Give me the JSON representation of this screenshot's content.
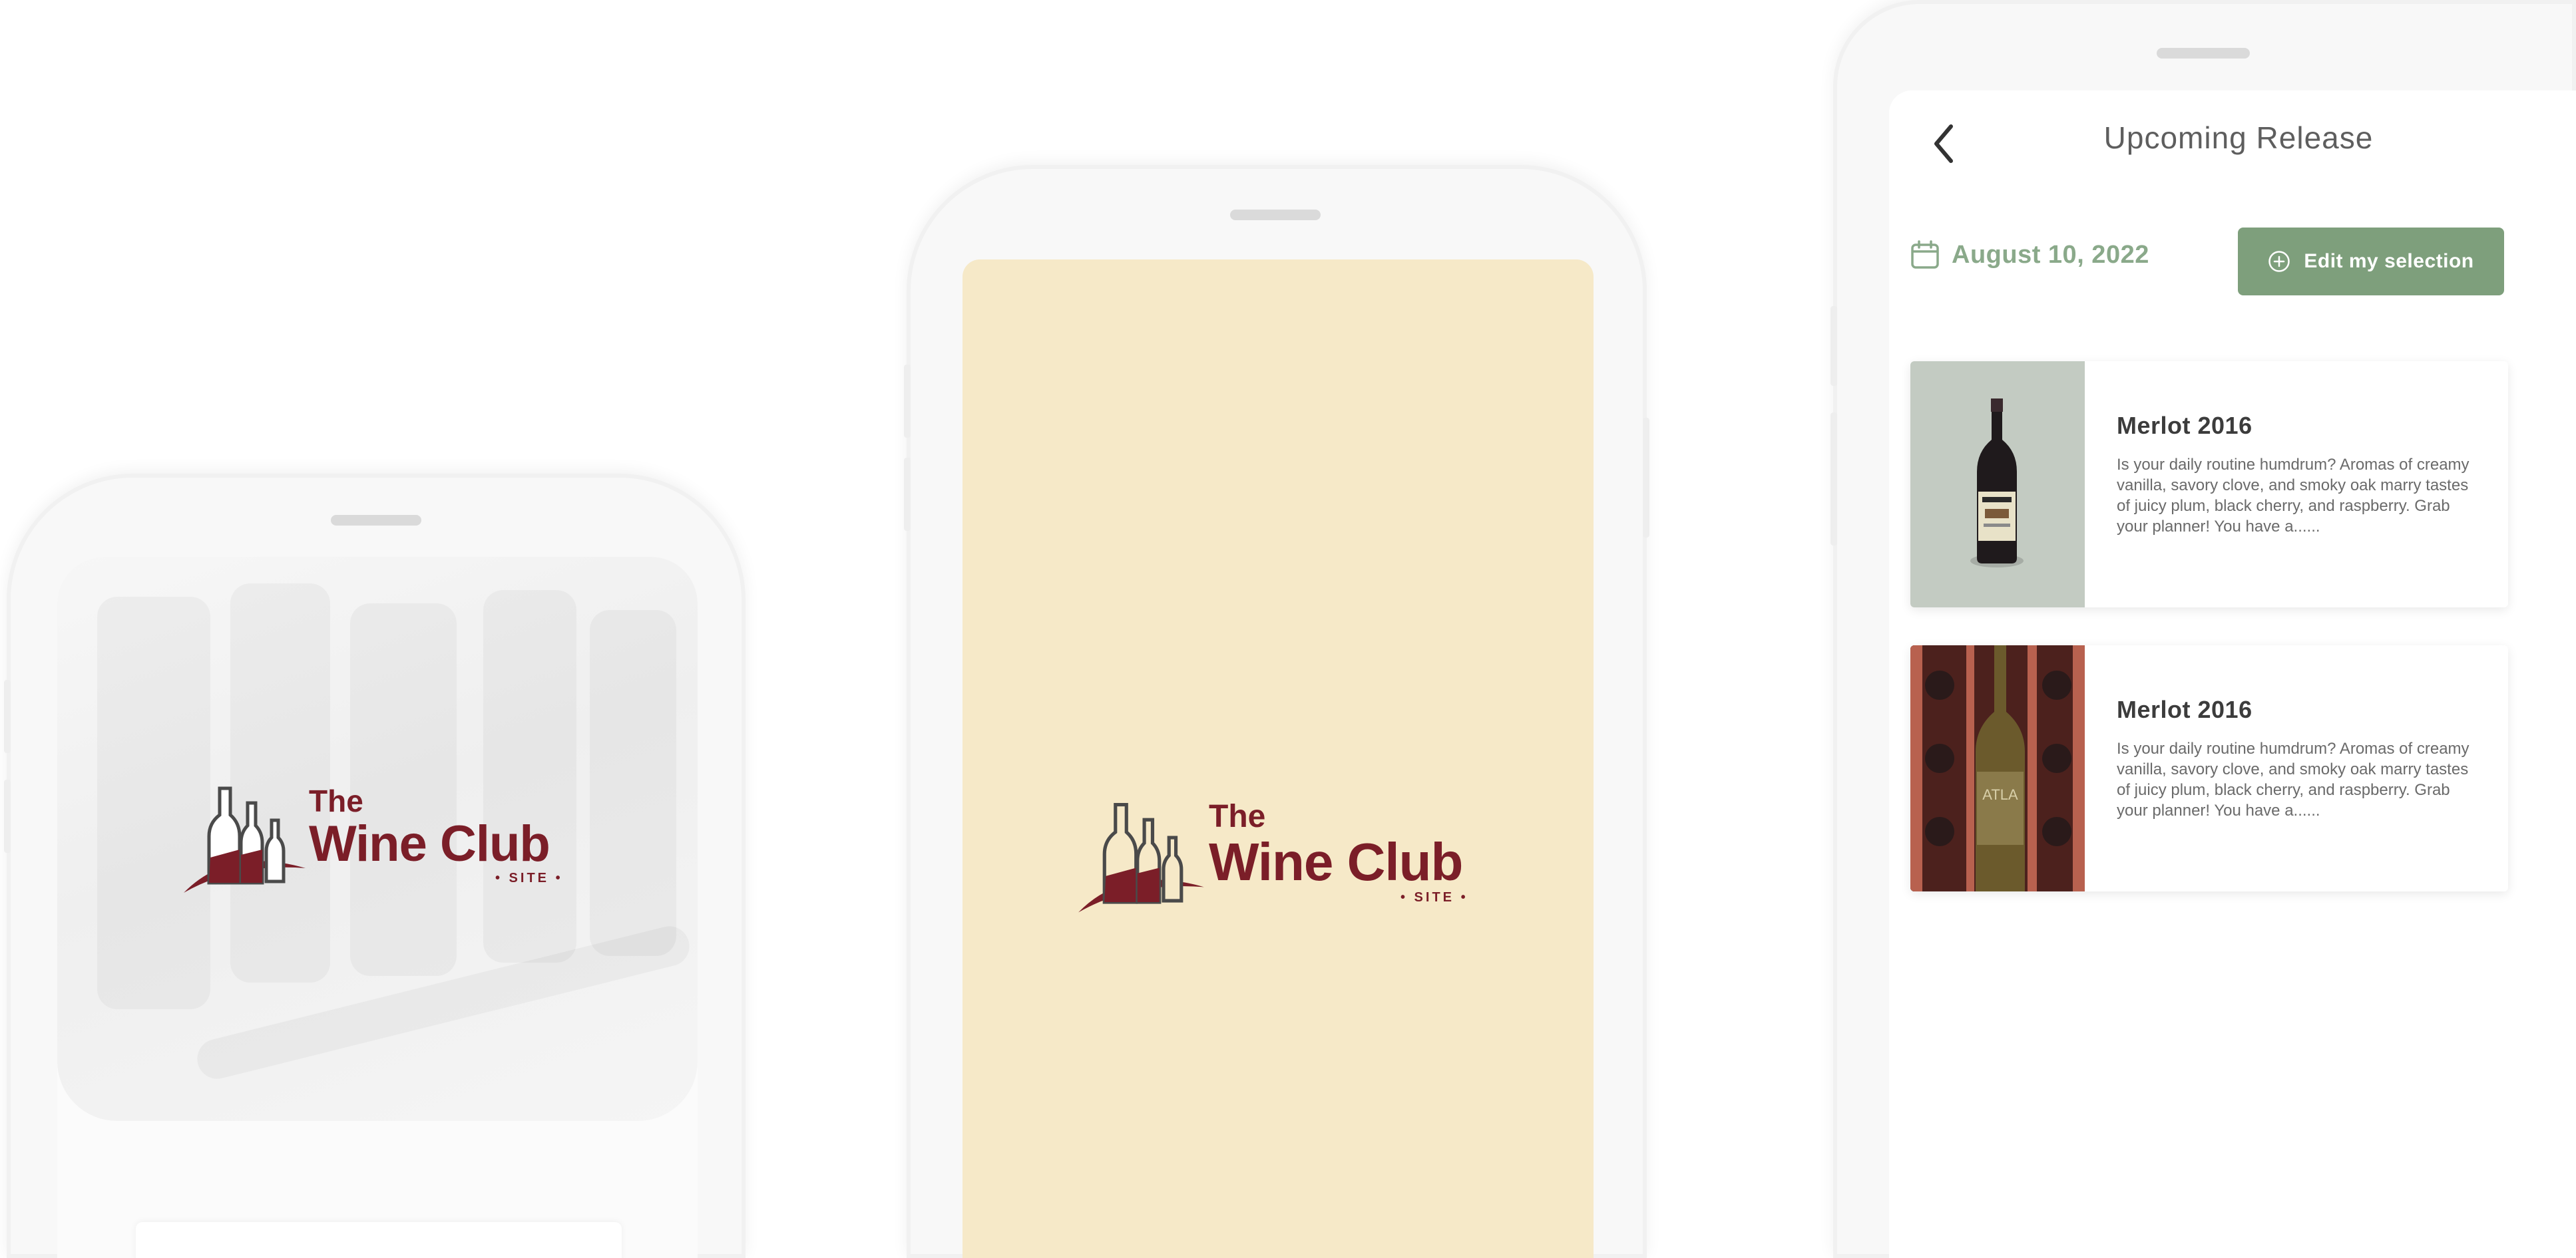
{
  "brand": {
    "line1": "The",
    "line2": "Wine Club",
    "line3": "• SITE •",
    "color": "#7b1e28"
  },
  "splash": {
    "background": "#f6e9c8"
  },
  "release": {
    "title": "Upcoming Release",
    "date": "August 10, 2022",
    "edit_label": "Edit my selection",
    "accent": "#7e9f7c",
    "wines": [
      {
        "name": "Merlot 2016",
        "description": "Is your daily routine humdrum? Aromas of creamy vanilla, savory clove, and smoky oak marry tastes of juicy plum, black cherry, and raspberry. Grab your planner! You have a......",
        "label": ""
      },
      {
        "name": "Merlot 2016",
        "description": "Is your daily routine humdrum? Aromas of creamy vanilla, savory clove, and smoky oak marry tastes of juicy plum, black cherry, and raspberry. Grab your planner! You have a......",
        "label": "ATLA"
      }
    ]
  }
}
